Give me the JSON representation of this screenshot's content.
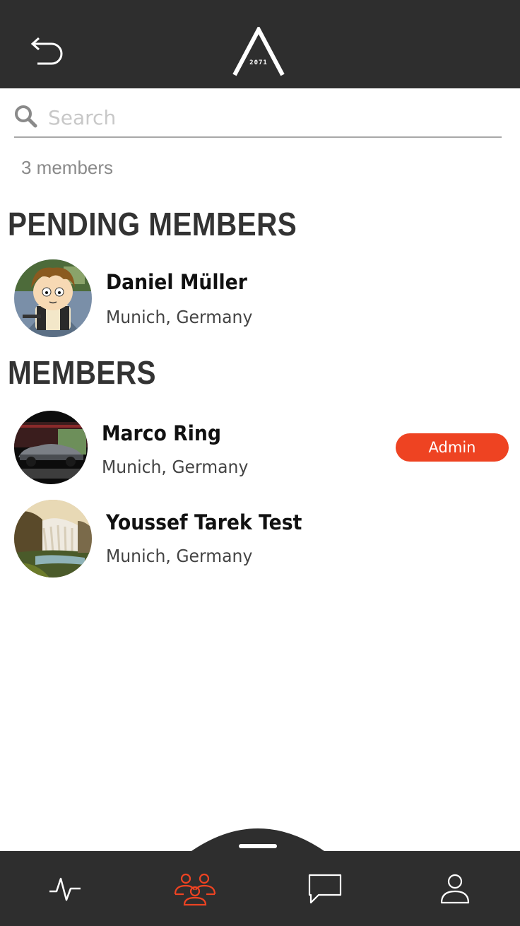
{
  "header": {
    "back_icon": "back-arrow-icon",
    "logo_text": "2071"
  },
  "search": {
    "placeholder": "Search",
    "value": ""
  },
  "member_count": "3 members",
  "pending_section": {
    "title": "PENDING MEMBERS",
    "members": [
      {
        "name": "Daniel Müller",
        "location": "Munich, Germany",
        "avatar": "cartoon-avatar"
      }
    ]
  },
  "members_section": {
    "title": "MEMBERS",
    "members": [
      {
        "name": "Marco Ring",
        "location": "Munich, Germany",
        "badge": "Admin",
        "avatar": "car-photo-avatar"
      },
      {
        "name": "Youssef Tarek Test",
        "location": "Munich, Germany",
        "avatar": "waterfall-photo-avatar"
      }
    ]
  },
  "bottom_nav": {
    "items": [
      {
        "icon": "activity-icon",
        "active": false
      },
      {
        "icon": "members-icon",
        "active": true
      },
      {
        "icon": "chat-icon",
        "active": false
      },
      {
        "icon": "profile-icon",
        "active": false
      }
    ]
  },
  "colors": {
    "bar": "#2e2e2e",
    "accent": "#ee4322",
    "heading": "#333333",
    "icon_inactive": "#ffffff"
  }
}
